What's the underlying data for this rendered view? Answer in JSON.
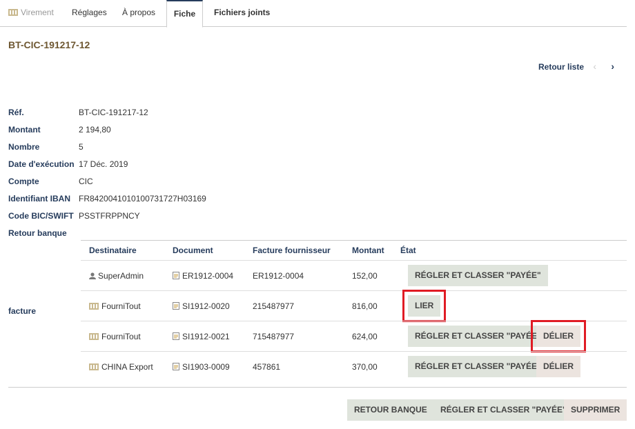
{
  "tabs": [
    {
      "label": "Virement",
      "icon": "bank-icon"
    },
    {
      "label": "Réglages"
    },
    {
      "label": "À propos"
    },
    {
      "label": "Fiche",
      "active": true
    },
    {
      "label": "Fichiers joints"
    }
  ],
  "title": "BT-CIC-191217-12",
  "nav": {
    "back_label": "Retour liste",
    "prev": "‹",
    "next": "›"
  },
  "fields": [
    {
      "label": "Réf.",
      "value": "BT-CIC-191217-12"
    },
    {
      "label": "Montant",
      "value": "2 194,80"
    },
    {
      "label": "Nombre",
      "value": "5"
    },
    {
      "label": "Date d'exécution",
      "value": "17 Déc. 2019"
    },
    {
      "label": "Compte",
      "value": "CIC"
    },
    {
      "label": "Identifiant IBAN",
      "value": "FR8420041010100731727H03169"
    },
    {
      "label": "Code BIC/SWIFT",
      "value": "PSSTFRPPNCY"
    },
    {
      "label": "Retour banque",
      "value": ""
    }
  ],
  "facture_label": "facture",
  "table": {
    "headers": [
      "Destinataire",
      "Document",
      "Facture fournisseur",
      "Montant",
      "État"
    ],
    "rows": [
      {
        "dest": "SuperAdmin",
        "dest_icon": "user-icon",
        "doc": "ER1912-0004",
        "facture": "ER1912-0004",
        "montant": "152,00",
        "btn1": "RÉGLER ET CLASSER \"PAYÉE\"",
        "btn2": ""
      },
      {
        "dest": "FourniTout",
        "dest_icon": "company-icon",
        "doc": "SI1912-0020",
        "facture": "215487977",
        "montant": "816,00",
        "btn1": "LIER",
        "btn2": ""
      },
      {
        "dest": "FourniTout",
        "dest_icon": "company-icon",
        "doc": "SI1912-0021",
        "facture": "715487977",
        "montant": "624,00",
        "btn1": "RÉGLER ET CLASSER \"PAYÉE\"",
        "btn2": "DÉLIER"
      },
      {
        "dest": "CHINA Export",
        "dest_icon": "company-icon",
        "doc": "SI1903-0009",
        "facture": "457861",
        "montant": "370,00",
        "btn1": "RÉGLER ET CLASSER \"PAYÉE\"",
        "btn2": "DÉLIER"
      }
    ]
  },
  "actions": {
    "retour_banque": "RETOUR BANQUE",
    "regler": "RÉGLER ET CLASSER \"PAYÉE\"",
    "supprimer": "SUPPRIMER"
  },
  "colors": {
    "accent": "#263c5c",
    "title": "#6e5731",
    "highlight": "#e01b24",
    "green_btn": "#dfe4dc",
    "pink_btn": "#ece4df"
  }
}
